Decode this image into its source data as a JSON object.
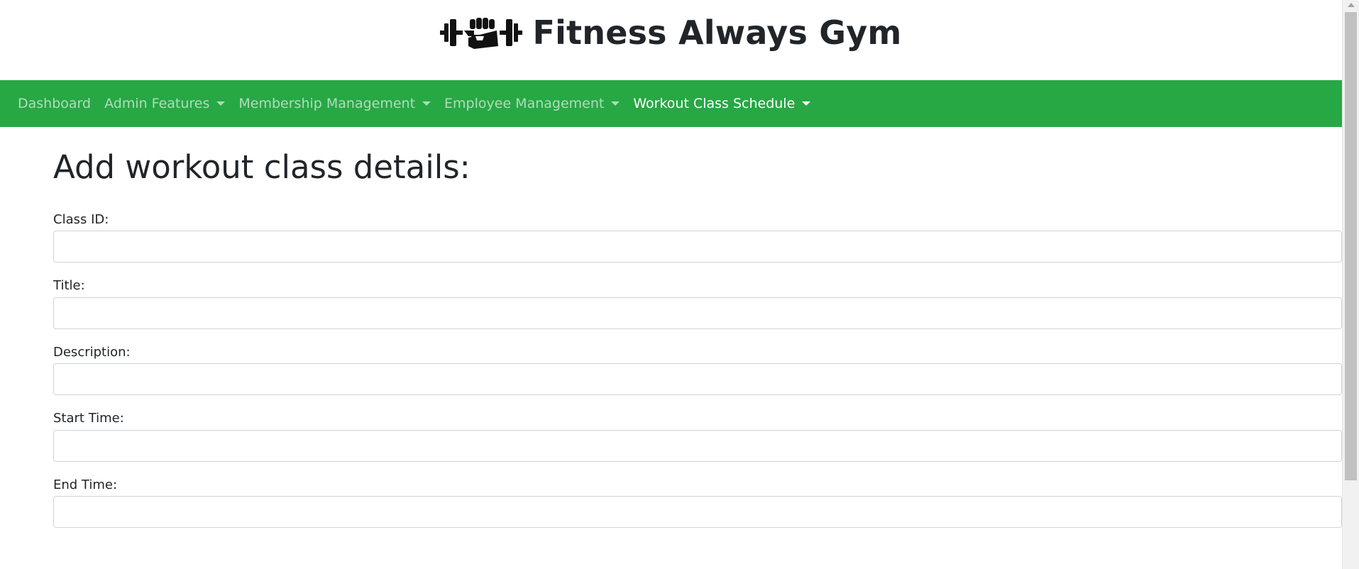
{
  "header": {
    "logo_icon": "dumbbell-fist-icon",
    "title": "Fitness Always Gym"
  },
  "nav": {
    "background_color": "#28a745",
    "items": [
      {
        "label": "Dashboard",
        "dropdown": false,
        "active": false
      },
      {
        "label": "Admin Features",
        "dropdown": true,
        "active": false
      },
      {
        "label": "Membership Management",
        "dropdown": true,
        "active": false
      },
      {
        "label": "Employee Management",
        "dropdown": true,
        "active": false
      },
      {
        "label": "Workout Class Schedule",
        "dropdown": true,
        "active": true
      }
    ]
  },
  "main": {
    "heading": "Add workout class details:",
    "fields": [
      {
        "label": "Class ID:",
        "value": "",
        "placeholder": ""
      },
      {
        "label": "Title:",
        "value": "",
        "placeholder": ""
      },
      {
        "label": "Description:",
        "value": "",
        "placeholder": ""
      },
      {
        "label": "Start Time:",
        "value": "",
        "placeholder": ""
      },
      {
        "label": "End Time:",
        "value": "",
        "placeholder": ""
      }
    ]
  }
}
